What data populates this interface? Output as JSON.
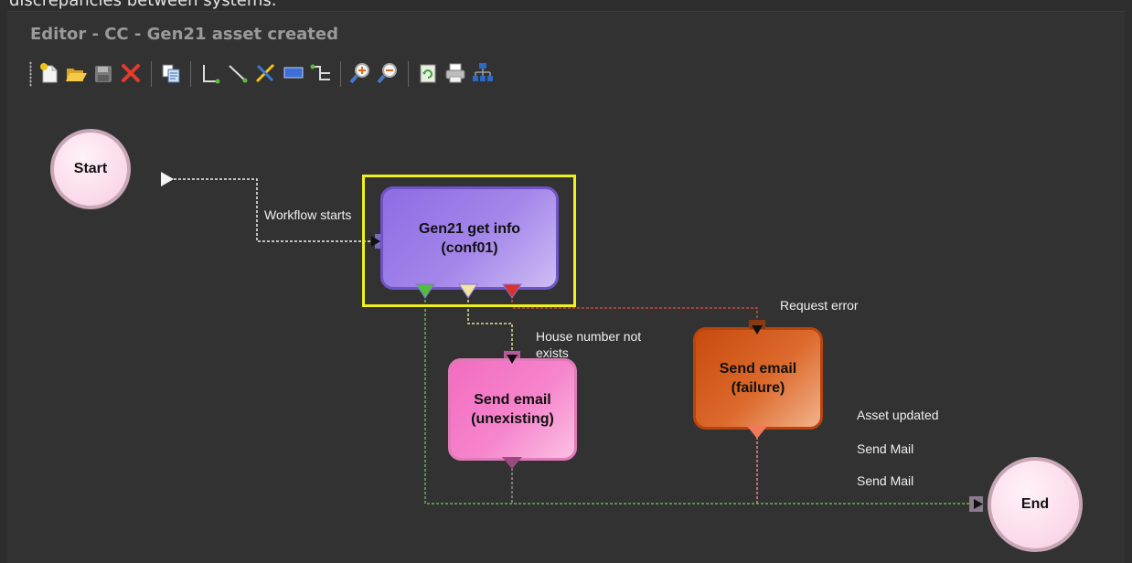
{
  "page": {
    "top_text": "discrepancies between systems.",
    "title": "Editor - CC - Gen21 asset created"
  },
  "toolbar": {
    "buttons": [
      {
        "name": "new-icon"
      },
      {
        "name": "open-icon"
      },
      {
        "name": "save-icon"
      },
      {
        "name": "delete-icon"
      },
      {
        "name": "copy-icon"
      },
      {
        "name": "elbow-connector-icon"
      },
      {
        "name": "straight-connector-icon"
      },
      {
        "name": "remove-connector-icon"
      },
      {
        "name": "rectangle-icon"
      },
      {
        "name": "route-connector-icon"
      },
      {
        "name": "zoom-in-icon"
      },
      {
        "name": "zoom-out-icon"
      },
      {
        "name": "refresh-icon"
      },
      {
        "name": "print-icon"
      },
      {
        "name": "hierarchy-icon"
      }
    ]
  },
  "workflow": {
    "start": "Start",
    "end": "End",
    "gen21": {
      "line1": "Gen21 get info",
      "line2": "(conf01)"
    },
    "unexisting": {
      "line1": "Send email",
      "line2": "(unexisting)"
    },
    "failure": {
      "line1": "Send email",
      "line2": "(failure)"
    },
    "labels": {
      "workflow_starts": "Workflow starts",
      "house_number_1": "House number not",
      "house_number_2": "exists",
      "request_error": "Request error",
      "asset_updated": "Asset updated",
      "send_mail_1": "Send Mail",
      "send_mail_2": "Send Mail"
    },
    "colors": {
      "selection": "#f0f020",
      "gen21": "#9a78e4",
      "unexisting": "#f07ac6",
      "failure": "#d2581a",
      "success_line": "#5ab94a",
      "warning_line": "#e8dc8a",
      "error_line": "#d04a40"
    }
  }
}
